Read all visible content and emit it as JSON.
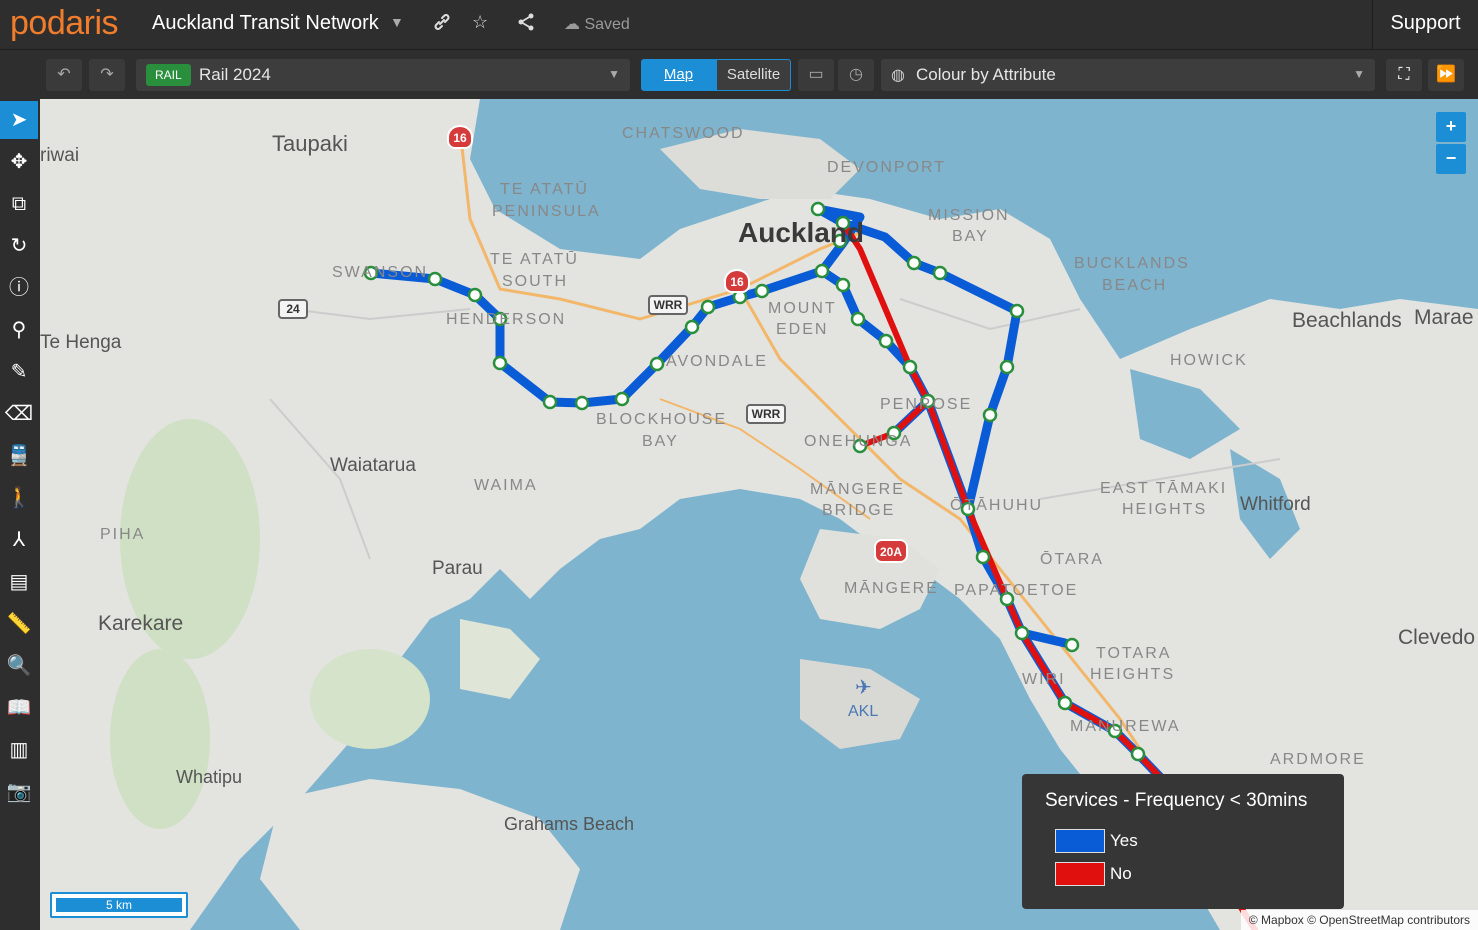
{
  "header": {
    "logo": "podaris",
    "project_title": "Auckland Transit Network",
    "saved_label": "Saved",
    "support_label": "Support"
  },
  "toolbar": {
    "scenario_tag": "RAIL",
    "scenario_name": "Rail 2024",
    "map_label": "Map",
    "satellite_label": "Satellite",
    "colour_mode": "Colour by Attribute"
  },
  "map": {
    "places": {
      "taupaki": "Taupaki",
      "riwai": "riwai",
      "chatswood": "CHATSWOOD",
      "devonport": "DEVONPORT",
      "te_atatu": "TE ATATŪ",
      "peninsula": "PENINSULA",
      "auckland": "Auckland",
      "mission": "MISSION",
      "bay": "BAY",
      "te_atatu2": "TE ATATŪ",
      "south": "SOUTH",
      "swanson": "SWANSON",
      "bucklands": "BUCKLANDS",
      "beach": "BEACH",
      "henderson": "HENDERSON",
      "mount": "MOUNT",
      "eden": "EDEN",
      "beachlands": "Beachlands",
      "marae": "Marae",
      "te_henga": "Te Henga",
      "howick": "HOWICK",
      "avondale": "AVONDALE",
      "blockhouse": "BLOCKHOUSE",
      "bay2": "BAY",
      "penrose": "PENROSE",
      "onehunga": "ONEHUNGA",
      "waiatarua": "Waiatarua",
      "waima": "WAIMA",
      "mangere_bridge": "MĀNGERE",
      "bridge": "BRIDGE",
      "otahuhu": "ŌTĀHUHU",
      "east_tamaki": "EAST TĀMAKI",
      "heights": "HEIGHTS",
      "whitford": "Whitford",
      "piha": "PIHA",
      "parau": "Parau",
      "otara": "ŌTARA",
      "mangere": "MĀNGERE",
      "papatoetoe": "PAPATOETOE",
      "karekare": "Karekare",
      "clevedon": "Clevedo",
      "totara": "TOTARA",
      "heights2": "HEIGHTS",
      "wiri": "WIRI",
      "akl": "AKL",
      "manurewa": "MANUREWA",
      "ardmore": "ARDMORE",
      "whatipu": "Whatipu",
      "grahams_beach": "Grahams Beach"
    },
    "shields": {
      "s16a": "16",
      "s16b": "16",
      "s24": "24",
      "wrr1": "WRR",
      "wrr2": "WRR",
      "s20a": "20A"
    },
    "zoom_in": "+",
    "zoom_out": "−",
    "scale_label": "5 km",
    "attribution": "© Mapbox © OpenStreetMap contributors"
  },
  "legend": {
    "title": "Services - Frequency < 30mins",
    "items": [
      {
        "label": "Yes",
        "color": "#0a5bd6"
      },
      {
        "label": "No",
        "color": "#e0100f"
      }
    ]
  },
  "colors": {
    "accent": "#1b8ed6",
    "yes_line": "#0a5bd6",
    "no_line": "#e0100f",
    "rail_tag": "#2a8f3c",
    "logo": "#f07d2c"
  }
}
